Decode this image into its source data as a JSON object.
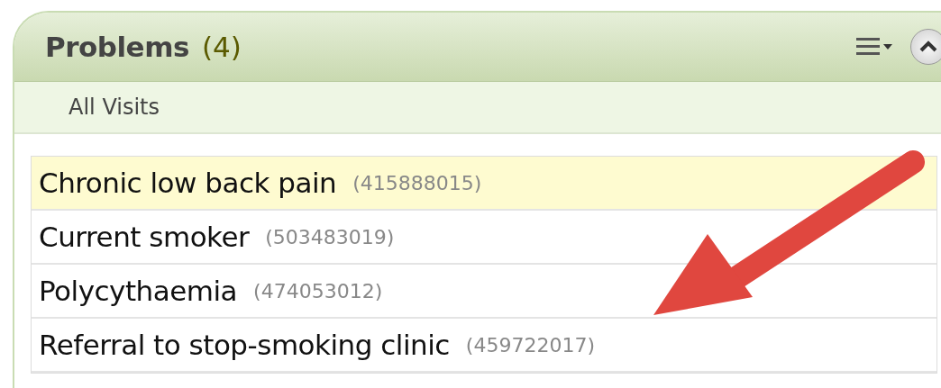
{
  "panel": {
    "title": "Problems",
    "count": "(4)",
    "filter": "All Visits"
  },
  "problems": [
    {
      "name": "Chronic low back pain",
      "code": "(415888015)",
      "selected": true
    },
    {
      "name": "Current smoker",
      "code": "(503483019)",
      "selected": false
    },
    {
      "name": "Polycythaemia",
      "code": "(474053012)",
      "selected": false
    },
    {
      "name": "Referral to stop-smoking clinic",
      "code": "(459722017)",
      "selected": false
    }
  ]
}
